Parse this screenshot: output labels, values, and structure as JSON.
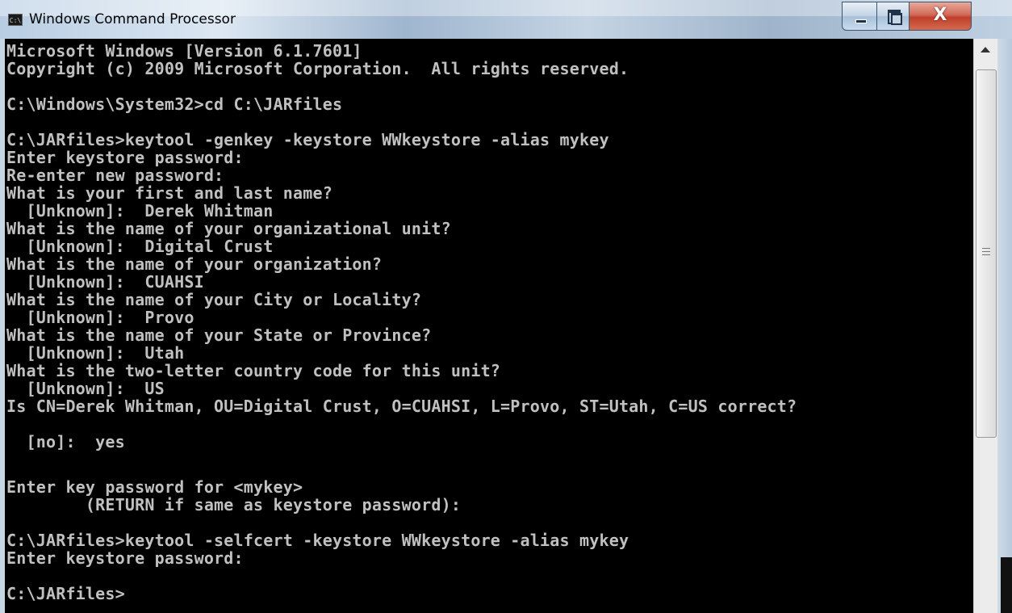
{
  "window": {
    "title": "Windows Command Processor",
    "icon": "cmd-icon",
    "icon_text": "C:\\",
    "close_symbol": "X"
  },
  "console": {
    "lines": [
      "Microsoft Windows [Version 6.1.7601]",
      "Copyright (c) 2009 Microsoft Corporation.  All rights reserved.",
      "",
      "C:\\Windows\\System32>cd C:\\JARfiles",
      "",
      "C:\\JARfiles>keytool -genkey -keystore WWkeystore -alias mykey",
      "Enter keystore password:",
      "Re-enter new password:",
      "What is your first and last name?",
      "  [Unknown]:  Derek Whitman",
      "What is the name of your organizational unit?",
      "  [Unknown]:  Digital Crust",
      "What is the name of your organization?",
      "  [Unknown]:  CUAHSI",
      "What is the name of your City or Locality?",
      "  [Unknown]:  Provo",
      "What is the name of your State or Province?",
      "  [Unknown]:  Utah",
      "What is the two-letter country code for this unit?",
      "  [Unknown]:  US",
      "Is CN=Derek Whitman, OU=Digital Crust, O=CUAHSI, L=Provo, ST=Utah, C=US correct?",
      "",
      "  [no]:  yes",
      "",
      "Enter key password for <mykey>",
      "        (RETURN if same as keystore password):",
      "",
      "C:\\JARfiles>keytool -selfcert -keystore WWkeystore -alias mykey",
      "Enter keystore password:",
      "",
      "C:\\JARfiles>"
    ]
  },
  "colors": {
    "console_bg": "#000000",
    "console_text": "#c0c0c0"
  }
}
